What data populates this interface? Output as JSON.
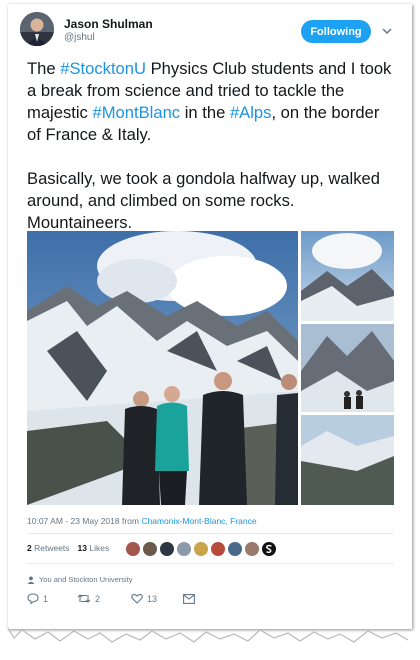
{
  "author": {
    "name": "Jason Shulman",
    "handle": "@jshul",
    "follow_label": "Following"
  },
  "tweet": {
    "segments": [
      {
        "text": "The ",
        "tag": false
      },
      {
        "text": "#StocktonU",
        "tag": true
      },
      {
        "text": " Physics Club students and I took a break from science and tried to tackle the majestic ",
        "tag": false
      },
      {
        "text": "#MontBlanc",
        "tag": true
      },
      {
        "text": " in the ",
        "tag": false
      },
      {
        "text": "#Alps",
        "tag": true
      },
      {
        "text": ", on the border of France & Italy.\n\nBasically, we took a gondola halfway up, walked around, and climbed on some rocks. Mountaineers.",
        "tag": false
      }
    ]
  },
  "meta": {
    "time": "10:07 AM - 23 May 2018 from ",
    "location": "Chamonix-Mont-Blanc, France"
  },
  "stats": {
    "retweets_count": "2",
    "retweets_label": "Retweets",
    "likes_count": "13",
    "likes_label": "Likes"
  },
  "context": {
    "text": "You and Stockton University"
  },
  "actions": {
    "reply_count": "1",
    "retweet_count": "2",
    "like_count": "13"
  },
  "colors": {
    "accent": "#1da1f2",
    "link": "#1b95e0",
    "muted": "#657786"
  },
  "icons": [
    "chevron-down-icon",
    "reply-icon",
    "retweet-icon",
    "heart-icon",
    "message-icon",
    "person-icon"
  ]
}
